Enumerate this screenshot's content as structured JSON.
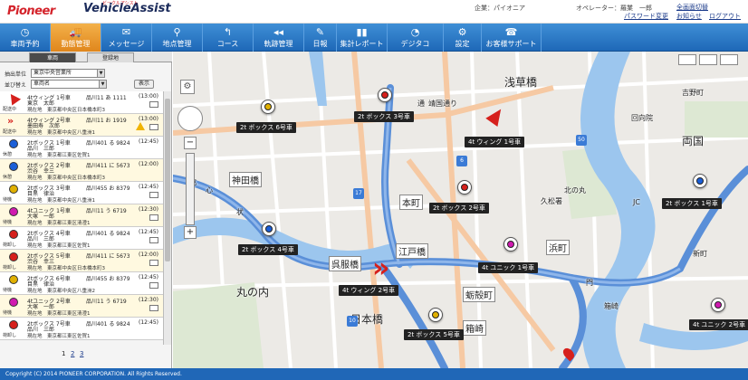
{
  "header": {
    "logo_pioneer": "Pioneer",
    "logo_product": "VehicleAssist",
    "logo_sub": "ビークルアシスト",
    "company_label": "企業：パイオニア",
    "operator_label": "オペレーター：羅業　一郎",
    "password_link": "パスワード変更",
    "fullscreen_link": "全画面切替",
    "notice_link": "お知らせ",
    "logout_link": "ログアウト"
  },
  "nav": [
    {
      "label": "車両予約",
      "icon": "◷"
    },
    {
      "label": "動態管理",
      "icon": "🚚"
    },
    {
      "label": "メッセージ",
      "icon": "✉"
    },
    {
      "label": "地点管理",
      "icon": "⚲"
    },
    {
      "label": "コース",
      "icon": "↰"
    },
    {
      "label": "軌跡管理",
      "icon": "◂◂"
    },
    {
      "label": "日報",
      "icon": "✎"
    },
    {
      "label": "集計レポート",
      "icon": "▮▮"
    },
    {
      "label": "デジタコ",
      "icon": "◔"
    },
    {
      "label": "設定",
      "icon": "⚙"
    },
    {
      "label": "お客様サポート",
      "icon": "☎"
    }
  ],
  "panel": {
    "tab_vehicle": "車両",
    "tab_registered": "登録地",
    "filter_office_label": "抽出単位",
    "filter_office_value": "東京中央営業所",
    "filter_sort_label": "並び替え",
    "filter_sort_value": "車両名",
    "show_button": "表示",
    "pages": [
      "1",
      "2",
      "3"
    ]
  },
  "vehicles": [
    {
      "icon": "arrow",
      "color": "#d6201c",
      "status": "配送中",
      "name": "4tウィング 1号車",
      "plate": "品川11 あ 1111",
      "time": "(13:00)",
      "driver": "東京　太郎",
      "loc": "現在地　東京都中央区日本橋本町3",
      "mail": true
    },
    {
      "icon": "double",
      "color": "#d6201c",
      "status": "配送中",
      "name": "4tウィング 2号車",
      "plate": "品川11 お 1919",
      "time": "(13:00)",
      "driver": "墨田寿　次郎",
      "loc": "現在地　東京都中央区八重洲1",
      "mail": true,
      "warn": true
    },
    {
      "icon": "circle",
      "color": "#1b5fd8",
      "status": "休憩",
      "name": "2tボックス 1号車",
      "plate": "品川401 る 9824",
      "time": "(12:45)",
      "driver": "品川　三郎",
      "loc": "現在地　東京都江東区佐賀1",
      "mail": false
    },
    {
      "icon": "circle",
      "color": "#1b5fd8",
      "status": "休憩",
      "name": "2tボックス 2号車",
      "plate": "品川411 に 5673",
      "time": "(12:00)",
      "driver": "渋谷　幸三",
      "loc": "現在地　東京都中央区日本橋本町3",
      "mail": false
    },
    {
      "icon": "circle",
      "color": "#e0b000",
      "status": "待機",
      "name": "2tボックス 3号車",
      "plate": "品川455 お 8379",
      "time": "(12:45)",
      "driver": "目黒　律治",
      "loc": "現在地　東京都中央区八重洲1",
      "mail": true
    },
    {
      "icon": "circle",
      "color": "#d01ab0",
      "status": "待機",
      "name": "4tユニック 1号車",
      "plate": "品川11 う 6719",
      "time": "(12:30)",
      "driver": "大塚　一郎",
      "loc": "現在地　東京都江東区清澄1",
      "mail": true
    },
    {
      "icon": "circle",
      "color": "#d6201c",
      "status": "荷卸し",
      "name": "2tボックス 4号車",
      "plate": "品川401 る 9824",
      "time": "(12:45)",
      "driver": "品川　三郎",
      "loc": "現在地　東京都江東区佐賀1",
      "mail": true
    },
    {
      "icon": "circle",
      "color": "#d6201c",
      "status": "荷卸し",
      "name": "2tボックス 5号車",
      "plate": "品川411 に 5673",
      "time": "(12:00)",
      "driver": "渋谷　幸三",
      "loc": "現在地　東京都中央区日本橋本町3",
      "mail": true
    },
    {
      "icon": "circle",
      "color": "#e0b000",
      "status": "待機",
      "name": "2tボックス 6号車",
      "plate": "品川455 お 8379",
      "time": "(12:45)",
      "driver": "目黒　律治",
      "loc": "現在地　東京都中央区八重洲2",
      "mail": true
    },
    {
      "icon": "circle",
      "color": "#d01ab0",
      "status": "待機",
      "name": "4tユニック 2号車",
      "plate": "品川11 う 6719",
      "time": "(12:30)",
      "driver": "大塚　一郎",
      "loc": "現在地　東京都江東区清澄1",
      "mail": true
    },
    {
      "icon": "circle",
      "color": "#d6201c",
      "status": "荷卸し",
      "name": "2tボックス 7号車",
      "plate": "品川401 る 9824",
      "time": "(12:45)",
      "driver": "品川　三郎",
      "loc": "現在地　東京都江東区佐賀1",
      "mail": false
    }
  ],
  "map": {
    "places": [
      {
        "text": "浅草橋",
        "big": true
      },
      {
        "text": "靖国通り"
      },
      {
        "text": "両国",
        "big": true
      },
      {
        "text": "神田橋",
        "wb": true
      },
      {
        "text": "本町",
        "wb": true
      },
      {
        "text": "江戸橋",
        "wb": true
      },
      {
        "text": "浜町",
        "wb": true
      },
      {
        "text": "呉服橋",
        "wb": true
      },
      {
        "text": "蛎殻町",
        "wb": true
      },
      {
        "text": "丸の内",
        "big": true
      },
      {
        "text": "日本橋",
        "big": true
      },
      {
        "text": "箱崎",
        "wb": true
      },
      {
        "text": "吉野町"
      },
      {
        "text": "回向院"
      },
      {
        "text": "久松署"
      },
      {
        "text": "北の丸"
      },
      {
        "text": "心"
      },
      {
        "text": "状"
      },
      {
        "text": "通"
      },
      {
        "text": "都"
      },
      {
        "text": "JC"
      },
      {
        "text": "新町"
      },
      {
        "text": "門"
      },
      {
        "text": "箱崎"
      }
    ],
    "roads": [
      "17",
      "6",
      "10",
      "50"
    ],
    "vehicle_labels": [
      {
        "text": "2t ボックス 6号車",
        "color": "#e0b000"
      },
      {
        "text": "2t ボックス 3号車",
        "color": "#d6201c"
      },
      {
        "text": "4t ウィング 1号車",
        "color": "#d6201c"
      },
      {
        "text": "2t ボックス 2号車",
        "color": "#d6201c"
      },
      {
        "text": "2t ボックス 1号車",
        "color": "#1b5fd8"
      },
      {
        "text": "2t ボックス 4号車",
        "color": "#1b5fd8"
      },
      {
        "text": "4t ユニック 2号車",
        "color": "#d01ab0"
      },
      {
        "text": "4t ウィング 2号車",
        "color": "#d6201c"
      },
      {
        "text": "2t ボックス 5号車",
        "color": "#e0b000"
      },
      {
        "text": "4t ユニック 1号車",
        "color": "#d01ab0"
      }
    ]
  },
  "footer": {
    "copyright": "Copyright (C) 2014 PIONEER CORPORATION. All Rights Reserved."
  }
}
